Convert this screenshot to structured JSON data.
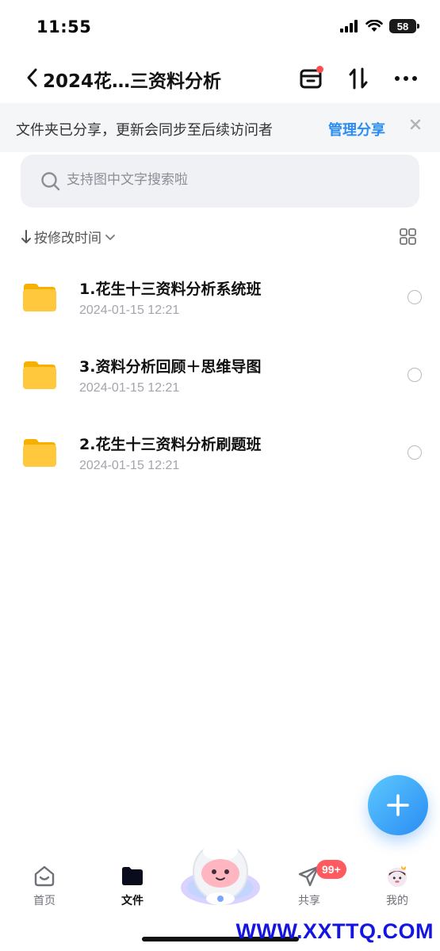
{
  "status_bar": {
    "time": "11:55",
    "battery": "58"
  },
  "header": {
    "title": "2024花…三资料分析"
  },
  "share_banner": {
    "text": "文件夹已分享，更新会同步至后续访问者",
    "action": "管理分享"
  },
  "search": {
    "placeholder": "支持图中文字搜索啦"
  },
  "sort": {
    "label": "按修改时间"
  },
  "files": [
    {
      "name": "1.花生十三资料分析系统班",
      "date": "2024-01-15 12:21"
    },
    {
      "name": "3.资料分析回顾＋思维导图",
      "date": "2024-01-15 12:21"
    },
    {
      "name": "2.花生十三资料分析刷题班",
      "date": "2024-01-15 12:21"
    }
  ],
  "tabbar": {
    "tabs": [
      {
        "label": "首页"
      },
      {
        "label": "文件"
      },
      {
        "label": "共享"
      },
      {
        "label": "我的"
      }
    ],
    "share_badge": "99+"
  },
  "watermark": "WWW.XXTTQ.COM",
  "colors": {
    "accent": "#2b8cf3",
    "folder": "#ffc83d",
    "badge": "#ff5a5f"
  }
}
